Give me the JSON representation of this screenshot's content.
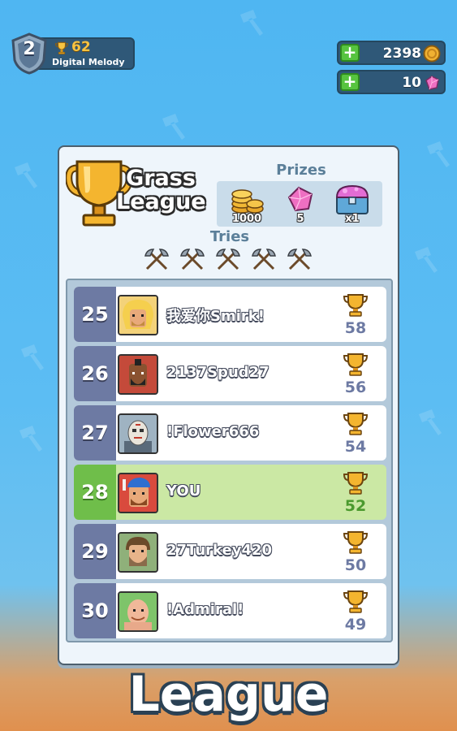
{
  "player": {
    "level": "2",
    "trophies": "62",
    "name": "Digital Melody"
  },
  "currencies": {
    "coins": "2398",
    "gems": "10",
    "plus_label": "+"
  },
  "league": {
    "title_line1": "Grass",
    "title_line2": "League",
    "prizes_label": "Prizes",
    "prizes": [
      {
        "icon": "coin-stack-icon",
        "amount": "1000"
      },
      {
        "icon": "gem-icon",
        "amount": "5"
      },
      {
        "icon": "treasure-chest-icon",
        "amount": "x1"
      }
    ],
    "tries_label": "Tries",
    "tries_count": 5
  },
  "leaderboard": [
    {
      "rank": "25",
      "name": "我爱你Smirk!",
      "score": "58",
      "avatar": "blonde-warrior-avatar",
      "is_you": false
    },
    {
      "rank": "26",
      "name": "2137Spud27",
      "score": "56",
      "avatar": "mohawk-warrior-avatar",
      "is_you": false
    },
    {
      "rank": "27",
      "name": "!Flower666",
      "score": "54",
      "avatar": "hockey-mask-avatar",
      "is_you": false
    },
    {
      "rank": "28",
      "name": "YOU",
      "score": "52",
      "avatar": "blue-cap-avatar",
      "is_you": true
    },
    {
      "rank": "29",
      "name": "27Turkey420",
      "score": "50",
      "avatar": "caveman-avatar",
      "is_you": false
    },
    {
      "rank": "30",
      "name": "!Admiral!",
      "score": "49",
      "avatar": "bald-warrior-avatar",
      "is_you": false
    }
  ],
  "footer": {
    "title": "League"
  },
  "colors": {
    "row_rank_bg": "#6d7aa3",
    "you_row_bg": "#cbe8a4",
    "you_rank_bg": "#6fbe4a",
    "gold": "#f6c342"
  }
}
